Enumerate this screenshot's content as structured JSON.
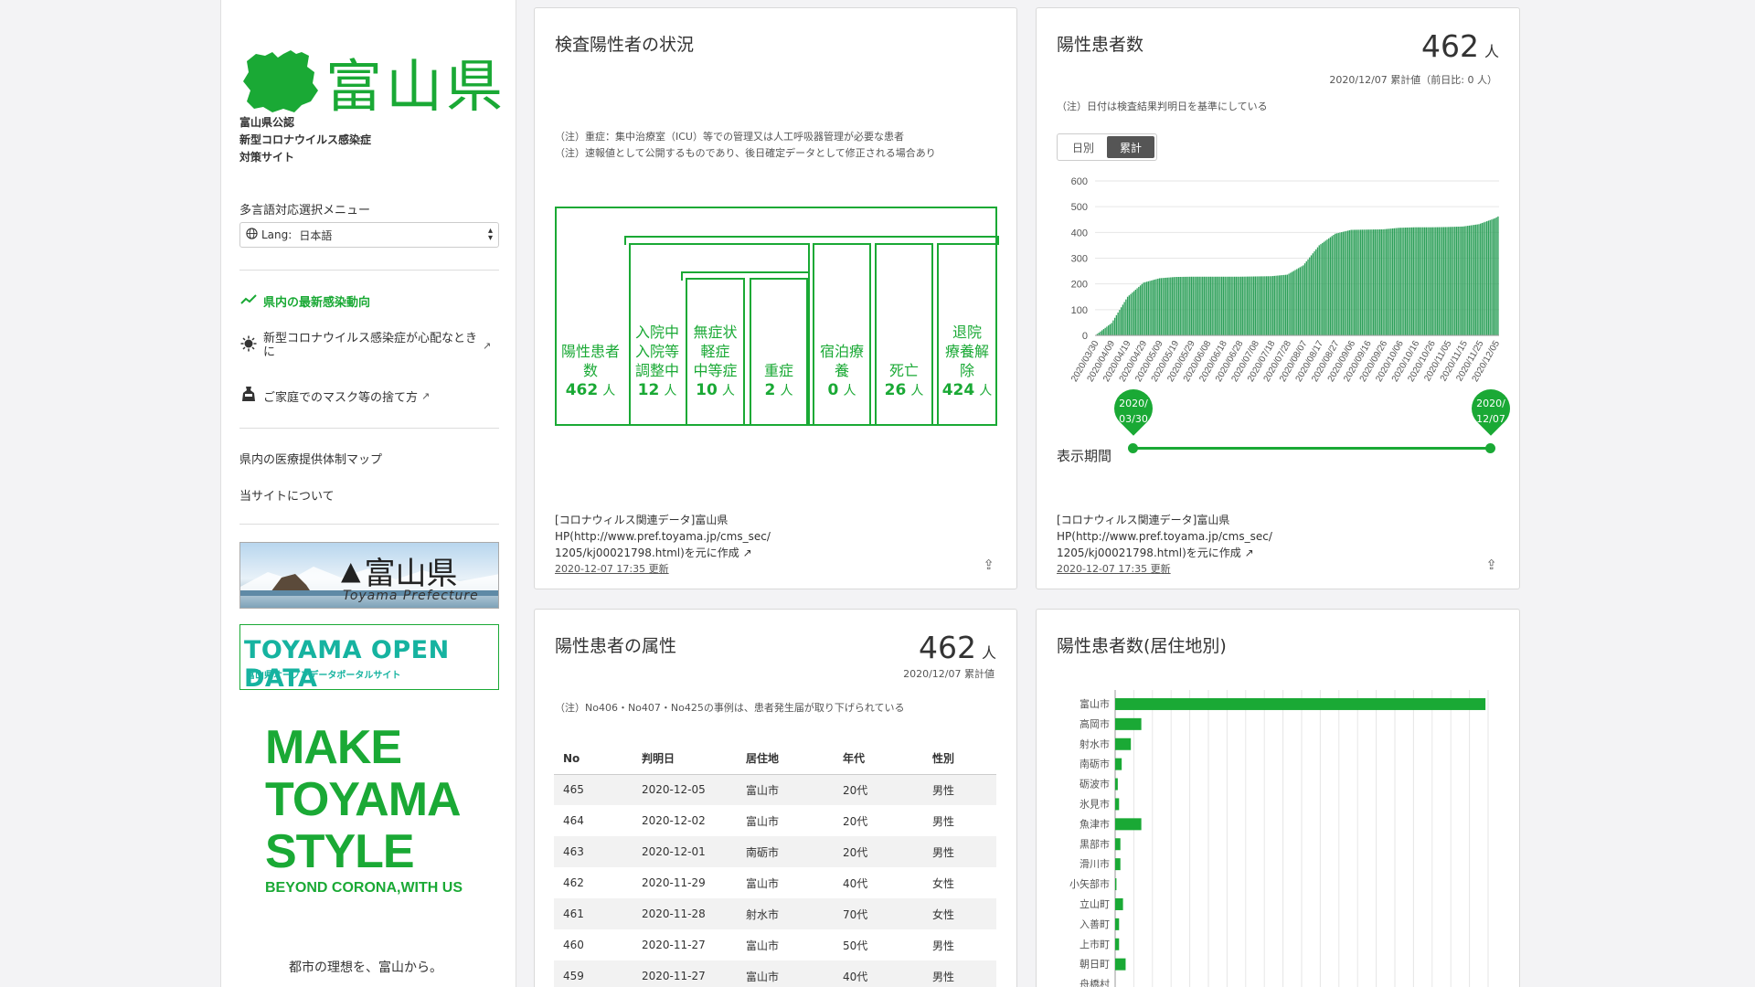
{
  "sidebar": {
    "logo_text": "富山県",
    "site_desc": [
      "富山県公認",
      "新型コロナウイルス感染症",
      "対策サイト"
    ],
    "lang_title": "多言語対応選択メニュー",
    "lang_label": "Lang:",
    "lang_value": "日本語",
    "nav": [
      {
        "label": "県内の最新感染動向",
        "icon": "trend-icon"
      },
      {
        "label": "新型コロナウイルス感染症が心配なときに",
        "icon": "virus-icon"
      },
      {
        "label": "ご家庭でのマスク等の捨て方",
        "icon": "trash-bag-icon"
      }
    ],
    "nav2": [
      "県内の医療提供体制マップ",
      "当サイトについて"
    ],
    "banner1_pref": "富山県",
    "banner1_en": "Toyama Prefecture",
    "banner2_title": "TOYAMA OPEN DATA",
    "banner2_sub": "富山県オープンデータポータルサイト",
    "make_lines": [
      "MAKE",
      "TOYAMA",
      "STYLE"
    ],
    "make_sub": "BEYOND CORONA,WITH US",
    "motto": "都市の理想を、富山から。"
  },
  "status_card": {
    "title": "検査陽性者の状況",
    "notes": [
      "（注）重症：集中治療室（ICU）等での管理又は人工呼吸器管理が必要な患者",
      "（注）速報値として公開するものであり、後日確定データとして修正される場合あり"
    ],
    "boxes": [
      {
        "lines": [
          "陽性患者",
          "数"
        ],
        "value": "462",
        "unit": "人"
      },
      {
        "lines": [
          "入院中",
          "入院等",
          "調整中"
        ],
        "value": "12",
        "unit": "人"
      },
      {
        "lines": [
          "無症状",
          "軽症",
          "中等症"
        ],
        "value": "10",
        "unit": "人"
      },
      {
        "lines": [
          "重症"
        ],
        "value": "2",
        "unit": "人"
      },
      {
        "lines": [
          "宿泊療",
          "養"
        ],
        "value": "0",
        "unit": "人"
      },
      {
        "lines": [
          "死亡"
        ],
        "value": "26",
        "unit": "人"
      },
      {
        "lines": [
          "退院",
          "療養解",
          "除"
        ],
        "value": "424",
        "unit": "人"
      }
    ],
    "source": [
      "[コロナウィルス関連データ]富山県",
      "HP(http://www.pref.toyama.jp/cms_sec/",
      "1205/kj00021798.html)を元に作成"
    ],
    "updated": "2020-12-07 17:35 更新"
  },
  "positive_card": {
    "title": "陽性患者数",
    "total": "462",
    "unit": "人",
    "sub": "2020/12/07 累計値（前日比: 0 人）",
    "note": "（注）日付は検査結果判明日を基準にしている",
    "toggle": [
      "日別",
      "累計"
    ],
    "range_label": "表示期間",
    "range_start": [
      "2020/",
      "03/30"
    ],
    "range_end": [
      "2020/",
      "12/07"
    ],
    "source": [
      "[コロナウィルス関連データ]富山県",
      "HP(http://www.pref.toyama.jp/cms_sec/",
      "1205/kj00021798.html)を元に作成"
    ],
    "updated": "2020-12-07 17:35 更新"
  },
  "attr_card": {
    "title": "陽性患者の属性",
    "total": "462",
    "unit": "人",
    "sub": "2020/12/07 累計値",
    "note": "（注）No406・No407・No425の事例は、患者発生届が取り下げられている",
    "headers": [
      "No",
      "判明日",
      "居住地",
      "年代",
      "性別"
    ],
    "rows": [
      [
        "465",
        "2020-12-05",
        "富山市",
        "20代",
        "男性"
      ],
      [
        "464",
        "2020-12-02",
        "富山市",
        "20代",
        "男性"
      ],
      [
        "463",
        "2020-12-01",
        "南砺市",
        "20代",
        "男性"
      ],
      [
        "462",
        "2020-11-29",
        "富山市",
        "40代",
        "女性"
      ],
      [
        "461",
        "2020-11-28",
        "射水市",
        "70代",
        "女性"
      ],
      [
        "460",
        "2020-11-27",
        "富山市",
        "50代",
        "男性"
      ],
      [
        "459",
        "2020-11-27",
        "富山市",
        "40代",
        "男性"
      ]
    ]
  },
  "residence_card": {
    "title": "陽性患者数(居住地別)"
  },
  "chart_data": [
    {
      "type": "area",
      "title": "陽性患者数",
      "ylim": [
        0,
        600
      ],
      "yticks": [
        0,
        100,
        200,
        300,
        400,
        500,
        600
      ],
      "xtick_labels": [
        "2020/03/30",
        "2020/04/09",
        "2020/04/19",
        "2020/04/29",
        "2020/05/09",
        "2020/05/19",
        "2020/05/29",
        "2020/06/08",
        "2020/06/18",
        "2020/06/28",
        "2020/07/08",
        "2020/07/18",
        "2020/07/28",
        "2020/08/07",
        "2020/08/17",
        "2020/08/27",
        "2020/09/06",
        "2020/09/16",
        "2020/09/26",
        "2020/10/06",
        "2020/10/16",
        "2020/10/26",
        "2020/11/05",
        "2020/11/15",
        "2020/11/25",
        "2020/12/05"
      ],
      "x": [
        "2020/03/30",
        "2020/04/09",
        "2020/04/19",
        "2020/04/29",
        "2020/05/09",
        "2020/05/19",
        "2020/05/29",
        "2020/06/08",
        "2020/06/18",
        "2020/06/28",
        "2020/07/08",
        "2020/07/18",
        "2020/07/28",
        "2020/08/07",
        "2020/08/17",
        "2020/08/27",
        "2020/09/06",
        "2020/09/16",
        "2020/09/26",
        "2020/10/06",
        "2020/10/16",
        "2020/10/26",
        "2020/11/05",
        "2020/11/15",
        "2020/11/25",
        "2020/12/05",
        "2020/12/07"
      ],
      "values": [
        1,
        48,
        150,
        205,
        222,
        227,
        228,
        228,
        228,
        228,
        229,
        230,
        236,
        272,
        350,
        395,
        410,
        411,
        412,
        418,
        420,
        420,
        421,
        423,
        432,
        455,
        462
      ],
      "grid": true,
      "color": "#2ea05a"
    },
    {
      "type": "bar",
      "title": "陽性患者数(居住地別)",
      "orientation": "horizontal",
      "categories": [
        "富山市",
        "高岡市",
        "射水市",
        "南砺市",
        "砺波市",
        "氷見市",
        "魚津市",
        "黒部市",
        "滑川市",
        "小矢部市",
        "立山町",
        "入善町",
        "上市町",
        "朝日町",
        "舟橋村"
      ],
      "values": [
        283,
        20,
        12,
        5,
        2,
        3,
        20,
        4,
        4,
        1,
        6,
        3,
        3,
        8,
        0
      ],
      "xlim": [
        0,
        285
      ],
      "grid": true,
      "color": "#1aa935"
    }
  ]
}
